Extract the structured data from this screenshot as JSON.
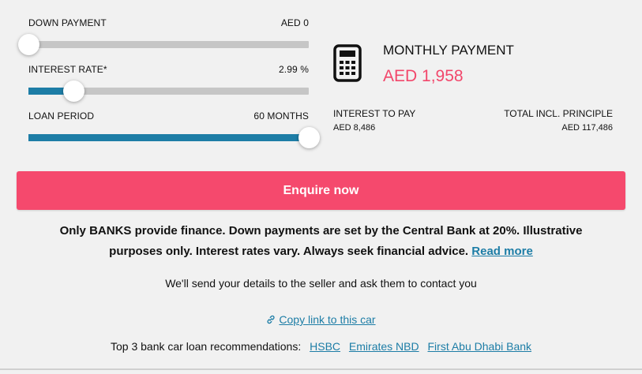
{
  "down_payment": {
    "label": "DOWN PAYMENT",
    "value": "AED 0",
    "level": 0.0
  },
  "interest_rate": {
    "label": "INTEREST RATE*",
    "value": "2.99 %",
    "level": 0.16
  },
  "loan_period": {
    "label": "LOAN PERIOD",
    "value": "60 MONTHS",
    "level": 1.0
  },
  "payment": {
    "icon": "calculator-icon",
    "label": "MONTHLY PAYMENT",
    "value": "AED 1,958",
    "interest_label": "INTEREST TO PAY",
    "interest_value": "AED 8,486",
    "total_label": "TOTAL INCL. PRINCIPLE",
    "total_value": "AED 117,486"
  },
  "enquire_label": "Enquire now",
  "disclaimer": {
    "text": "Only BANKS provide finance. Down payments are set by the Central Bank at 20%. Illustrative purposes only. Interest rates vary. Always seek financial advice.",
    "link": "Read more"
  },
  "send_note": "We'll send your details to the seller and ask them to contact you",
  "copy_link": {
    "icon": "link-icon",
    "label": "Copy link to this car"
  },
  "recommendations": {
    "label": "Top 3 bank car loan recommendations:",
    "banks": [
      "HSBC",
      "Emirates NBD",
      "First Abu Dhabi Bank"
    ]
  },
  "colors": {
    "accent": "#f5496d",
    "slider_fill": "#1d7da6",
    "link": "#1d7da6",
    "price": "#f2476b"
  }
}
